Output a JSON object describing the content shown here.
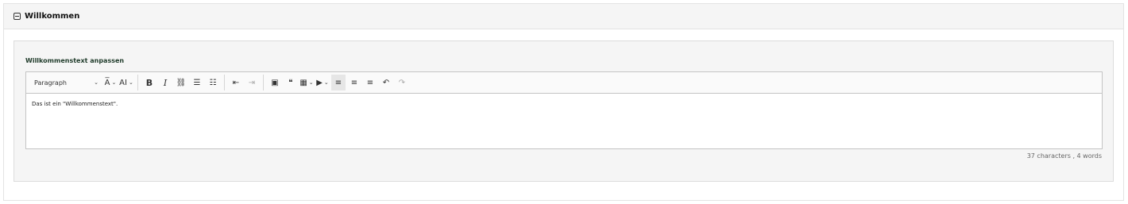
{
  "panel": {
    "title": "Willkommen"
  },
  "field": {
    "label": "Willkommenstext anpassen"
  },
  "toolbar": {
    "heading_select": "Paragraph",
    "font_size_glyph": "A̅",
    "font_family_glyph": "AI",
    "bold_glyph": "B",
    "italic_glyph": "I",
    "link_glyph": "⛓",
    "bullet_glyph": "☰",
    "numbered_glyph": "☷",
    "outdent_glyph": "⇤",
    "indent_glyph": "⇥",
    "image_glyph": "▣",
    "quote_glyph": "❝",
    "table_glyph": "▦",
    "media_glyph": "▶",
    "align_left_glyph": "≡",
    "align_right_glyph": "≡",
    "align_center_glyph": "≡",
    "undo_glyph": "↶",
    "redo_glyph": "↷"
  },
  "editor": {
    "content": "Das ist ein \"Willkommenstext\"."
  },
  "counter": {
    "text": "37 characters , 4 words"
  }
}
